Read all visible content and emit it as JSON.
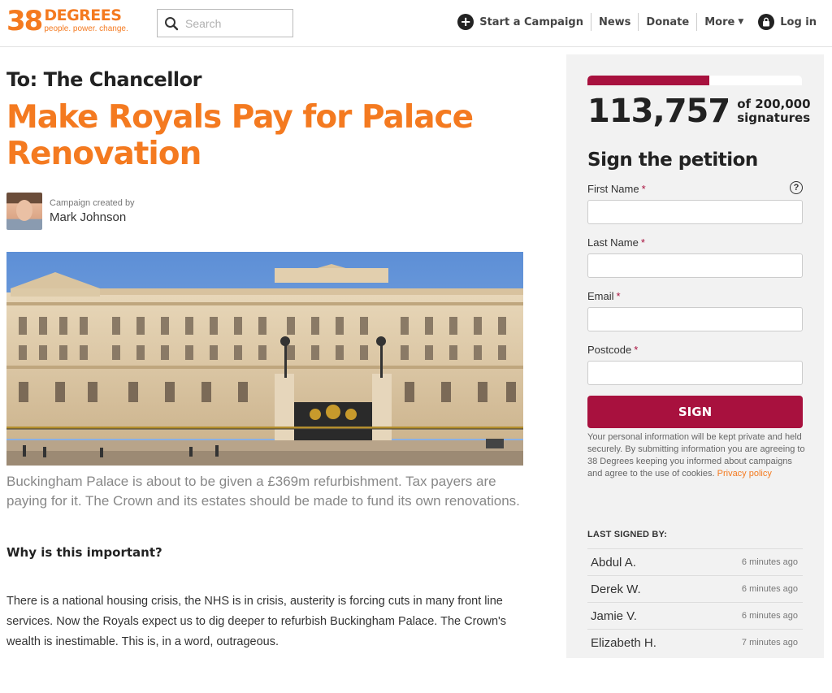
{
  "header": {
    "logo_number": "38",
    "logo_word": "DEGREES",
    "logo_tagline": "people. power. change.",
    "search_placeholder": "Search",
    "nav": {
      "start_campaign": "Start a Campaign",
      "news": "News",
      "donate": "Donate",
      "more": "More",
      "login": "Log in"
    }
  },
  "petition": {
    "to": "To: The Chancellor",
    "title": "Make Royals Pay for Palace Renovation",
    "creator_label": "Campaign created by",
    "creator_name": "Mark Johnson",
    "summary": "Buckingham Palace is about to be given a £369m refurbishment. Tax payers are paying for it. The Crown and its estates should be made to fund its own renovations.",
    "why_heading": "Why is this important?",
    "why_body": "There is a national housing crisis, the NHS is in crisis, austerity is forcing cuts in many front line services. Now the Royals expect us to dig deeper to refurbish Buckingham Palace. The Crown's wealth is inestimable. This is, in a word, outrageous."
  },
  "sidebar": {
    "signature_count": "113,757",
    "goal_line1": "of 200,000",
    "goal_line2": "signatures",
    "progress_fraction": 0.569,
    "sign_title": "Sign the petition",
    "help_symbol": "?",
    "fields": {
      "first_name": "First Name",
      "last_name": "Last Name",
      "email": "Email",
      "postcode": "Postcode",
      "required_mark": "*"
    },
    "sign_button": "SIGN",
    "privacy_text": "Your personal information will be kept private and held securely. By submitting information you are agreeing to 38 Degrees keeping you informed about campaigns and agree to the use of cookies.",
    "privacy_link": "Privacy policy",
    "last_signed_heading": "LAST SIGNED BY:",
    "last_signed": [
      {
        "name": "Abdul A.",
        "time": "6 minutes ago"
      },
      {
        "name": "Derek W.",
        "time": "6 minutes ago"
      },
      {
        "name": "Jamie V.",
        "time": "6 minutes ago"
      },
      {
        "name": "Elizabeth H.",
        "time": "7 minutes ago"
      }
    ]
  },
  "colors": {
    "brand_orange": "#f47a20",
    "sign_crimson": "#a8113e"
  }
}
